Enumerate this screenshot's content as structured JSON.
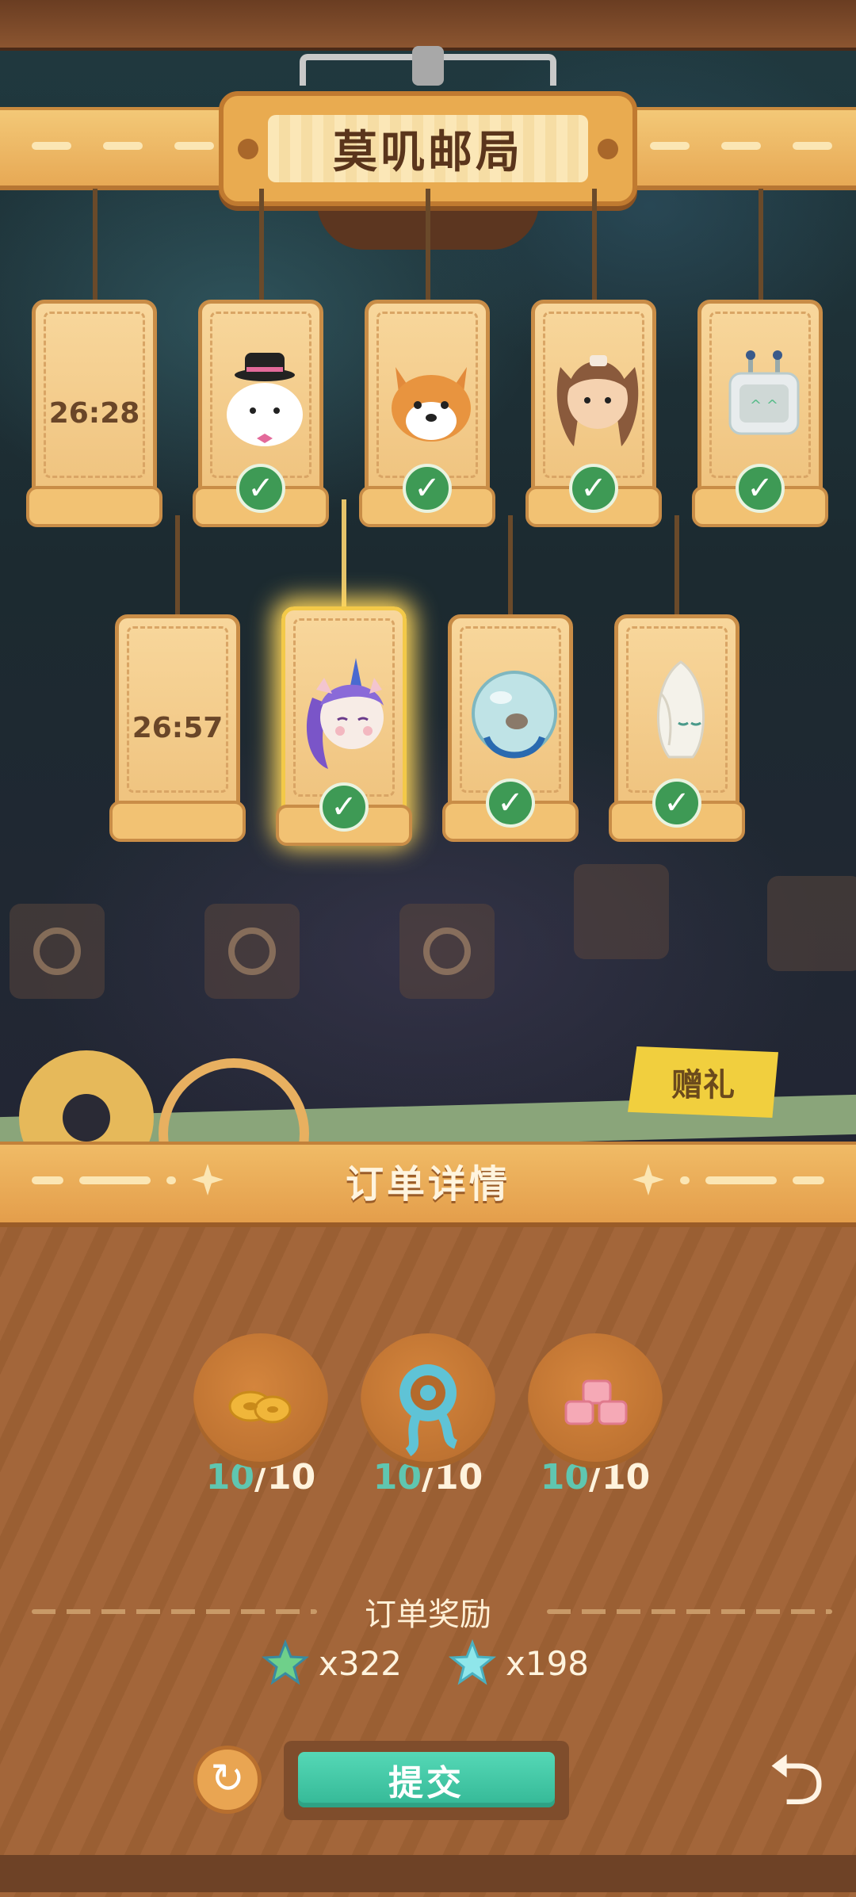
{
  "header": {
    "title": "莫叽邮局"
  },
  "cards_row1": [
    {
      "type": "timer",
      "timer": "26:28"
    },
    {
      "type": "portrait",
      "character": "seal-with-top-hat",
      "done": "✓"
    },
    {
      "type": "portrait",
      "character": "shiba-dog",
      "done": "✓"
    },
    {
      "type": "portrait",
      "character": "bunny-girl",
      "done": "✓"
    },
    {
      "type": "portrait",
      "character": "robot",
      "done": "✓"
    }
  ],
  "cards_row2": [
    {
      "type": "timer",
      "timer": "26:57"
    },
    {
      "type": "portrait",
      "character": "unicorn",
      "done": "✓",
      "selected": true
    },
    {
      "type": "portrait",
      "character": "hamster-ball",
      "done": "✓"
    },
    {
      "type": "portrait",
      "character": "white-flower-spirit",
      "done": "✓"
    }
  ],
  "gift_label": "赠礼",
  "order_details": {
    "title": "订单详情",
    "items": [
      {
        "icon": "cookie-icon",
        "have": "10",
        "need": "/10"
      },
      {
        "icon": "blue-swirl-icon",
        "have": "10",
        "need": "/10"
      },
      {
        "icon": "pink-candy-icon",
        "have": "10",
        "need": "/10"
      }
    ],
    "reward_title": "订单奖励",
    "rewards": [
      {
        "icon": "green-star-icon",
        "amount": "x322"
      },
      {
        "icon": "cyan-star-icon",
        "amount": "x198"
      }
    ]
  },
  "buttons": {
    "submit": "提交",
    "refresh": "↻",
    "back": "⮌"
  },
  "colors": {
    "accent_green": "#34b896",
    "count_have": "#5fc6b0",
    "check_green": "#3e9a55"
  }
}
